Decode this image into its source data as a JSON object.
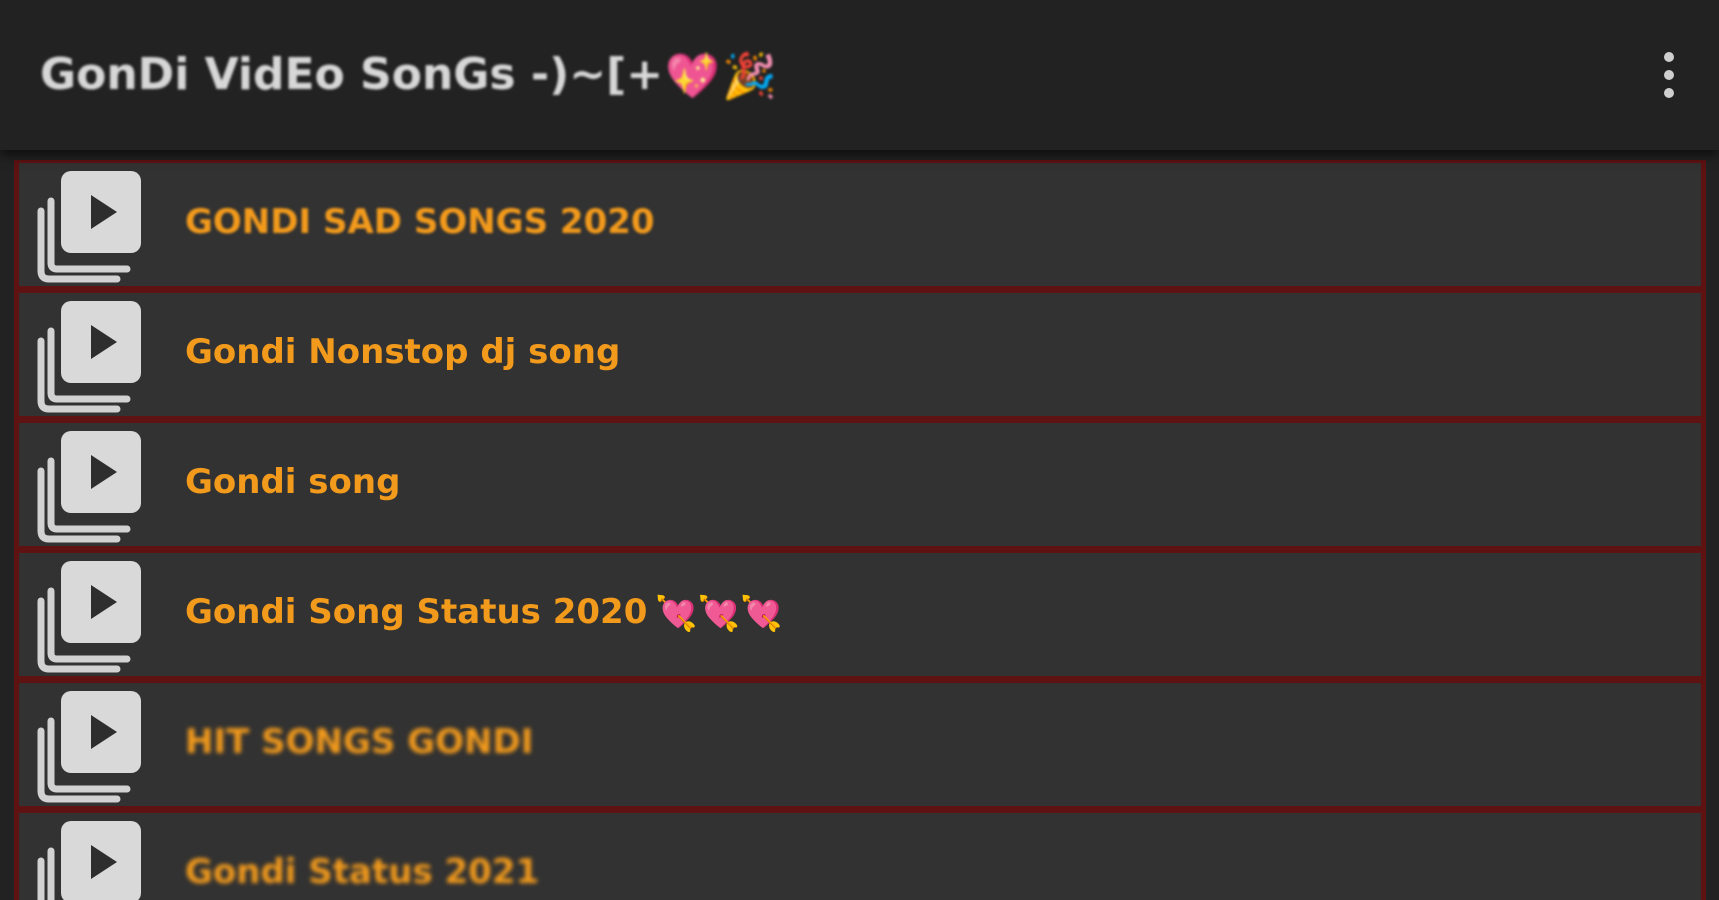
{
  "appbar": {
    "title": "GonDi VidEo SonGs -)~[+",
    "title_emojis": [
      "💖",
      "🎉"
    ],
    "menu_icon": "overflow-menu-icon"
  },
  "playlist": {
    "item_icon": "video-playlist-play-icon",
    "items": [
      {
        "label": "GONDI SAD SONGS 2020",
        "emoji": ""
      },
      {
        "label": "Gondi Nonstop dj song",
        "emoji": ""
      },
      {
        "label": "Gondi song",
        "emoji": ""
      },
      {
        "label": "Gondi Song Status 2020",
        "emoji": "💘💘💘"
      },
      {
        "label": "HIT SONGS GONDI",
        "emoji": ""
      },
      {
        "label": "Gondi Status 2021",
        "emoji": ""
      }
    ]
  },
  "colors": {
    "background": "#222222",
    "item_background": "#323232",
    "item_border": "#5e1212",
    "label_color": "#f29a1c",
    "title_color": "#d7d7d7"
  }
}
